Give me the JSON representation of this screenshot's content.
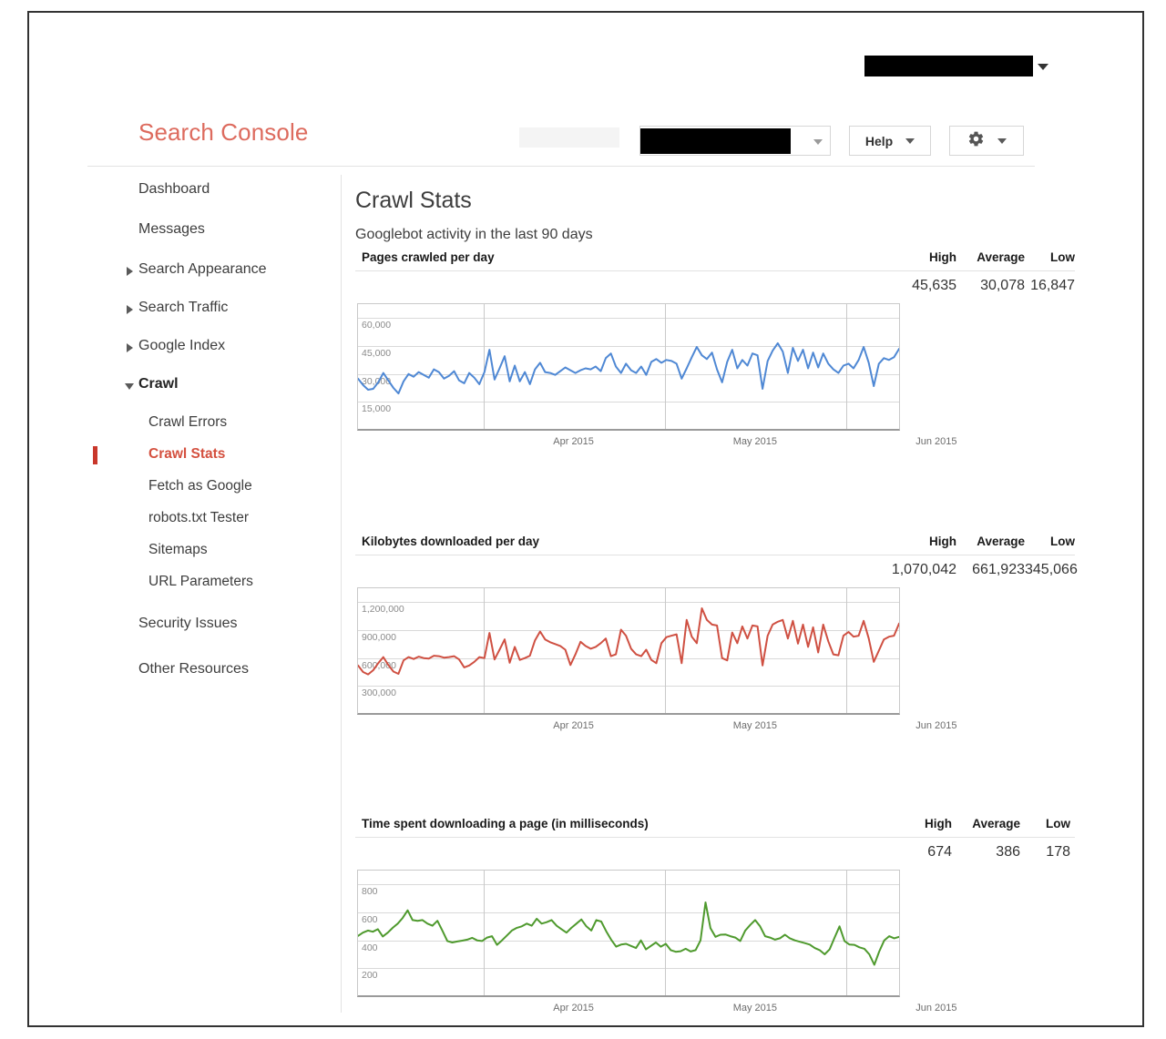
{
  "account_bar": {
    "account_chip_redacted": true,
    "caret_icon": "chevron-down-icon"
  },
  "header": {
    "brand": "Search Console",
    "property_select_redacted": true,
    "help_label": "Help",
    "gear_icon": "gear-icon",
    "caret_icon": "chevron-down-icon"
  },
  "sidebar": {
    "items": [
      {
        "label": "Dashboard",
        "type": "top"
      },
      {
        "label": "Messages",
        "type": "top"
      },
      {
        "label": "Search Appearance",
        "type": "group",
        "expanded": false
      },
      {
        "label": "Search Traffic",
        "type": "group",
        "expanded": false
      },
      {
        "label": "Google Index",
        "type": "group",
        "expanded": false
      },
      {
        "label": "Crawl",
        "type": "group",
        "expanded": true
      },
      {
        "label": "Crawl Errors",
        "type": "sub"
      },
      {
        "label": "Crawl Stats",
        "type": "sub",
        "active": true
      },
      {
        "label": "Fetch as Google",
        "type": "sub"
      },
      {
        "label": "robots.txt Tester",
        "type": "sub"
      },
      {
        "label": "Sitemaps",
        "type": "sub"
      },
      {
        "label": "URL Parameters",
        "type": "sub"
      },
      {
        "label": "Security Issues",
        "type": "plain"
      },
      {
        "label": "Other Resources",
        "type": "plain"
      }
    ]
  },
  "main": {
    "title": "Crawl Stats",
    "subtitle": "Googlebot activity in the last 90 days",
    "stat_headers": {
      "high": "High",
      "average": "Average",
      "low": "Low"
    },
    "charts": [
      {
        "title": "Pages crawled per day",
        "high": "45,635",
        "average": "30,078",
        "low": "16,847",
        "color": "#4f88d4"
      },
      {
        "title": "Kilobytes downloaded per day",
        "high": "1,070,042",
        "average": "661,923",
        "low": "345,066",
        "color": "#cf5042"
      },
      {
        "title": "Time spent downloading a page (in milliseconds)",
        "high": "674",
        "average": "386",
        "low": "178",
        "color": "#4f9a2e"
      }
    ]
  },
  "chart_data": [
    {
      "type": "line",
      "title": "Pages crawled per day",
      "xlabel": "",
      "ylabel": "",
      "ylim": [
        0,
        67500
      ],
      "yticks": [
        "60,000",
        "45,000",
        "30,000",
        "15,000"
      ],
      "ytick_values": [
        60000,
        45000,
        30000,
        15000
      ],
      "xticks": [
        "Apr 2015",
        "May 2015",
        "Jun 2015"
      ],
      "grid": true,
      "legend": "none",
      "color": "#4f88d4",
      "stats": {
        "high": 45635,
        "average": 30078,
        "low": 16847
      },
      "values": [
        27500,
        24000,
        21500,
        22000,
        25500,
        30500,
        26500,
        22500,
        19500,
        26000,
        30000,
        28500,
        31000,
        29500,
        28000,
        32500,
        31000,
        27500,
        29000,
        31500,
        26500,
        25000,
        30500,
        28000,
        24500,
        31000,
        43000,
        27000,
        33000,
        39500,
        26000,
        34500,
        26000,
        31000,
        24500,
        32500,
        36000,
        31000,
        30500,
        29500,
        31500,
        33500,
        32000,
        30500,
        32000,
        33000,
        32500,
        34000,
        31500,
        38500,
        41000,
        34000,
        30500,
        35500,
        32000,
        30500,
        34000,
        29500,
        36500,
        38000,
        36000,
        37500,
        37000,
        35500,
        27500,
        33000,
        39000,
        44500,
        40000,
        38000,
        41500,
        32500,
        25500,
        36500,
        43000,
        33000,
        37500,
        34500,
        41000,
        40000,
        22000,
        37000,
        42500,
        46500,
        42000,
        30500,
        44000,
        37000,
        43000,
        33000,
        41500,
        33500,
        41000,
        35500,
        32500,
        30500,
        34500,
        35500,
        33000,
        37500,
        44500,
        36000,
        23500,
        35500,
        38500,
        37500,
        39000,
        43500
      ]
    },
    {
      "type": "line",
      "title": "Kilobytes downloaded per day",
      "xlabel": "",
      "ylabel": "",
      "ylim": [
        0,
        1350000
      ],
      "yticks": [
        "1,200,000",
        "900,000",
        "600,000",
        "300,000"
      ],
      "ytick_values": [
        1200000,
        900000,
        600000,
        300000
      ],
      "xticks": [
        "Apr 2015",
        "May 2015",
        "Jun 2015"
      ],
      "grid": true,
      "legend": "none",
      "color": "#cf5042",
      "stats": {
        "high": 1070042,
        "average": 661923,
        "low": 345066
      },
      "values": [
        520000,
        450000,
        425000,
        470000,
        545000,
        610000,
        525000,
        455000,
        430000,
        575000,
        610000,
        590000,
        615000,
        600000,
        595000,
        625000,
        620000,
        605000,
        610000,
        620000,
        585000,
        500000,
        520000,
        560000,
        610000,
        600000,
        870000,
        585000,
        690000,
        800000,
        550000,
        720000,
        580000,
        600000,
        625000,
        790000,
        885000,
        800000,
        770000,
        750000,
        730000,
        690000,
        525000,
        640000,
        775000,
        730000,
        700000,
        720000,
        760000,
        810000,
        620000,
        640000,
        905000,
        840000,
        700000,
        640000,
        620000,
        690000,
        580000,
        545000,
        760000,
        825000,
        840000,
        855000,
        545000,
        1010000,
        830000,
        760000,
        1135000,
        1010000,
        960000,
        950000,
        600000,
        575000,
        875000,
        760000,
        940000,
        810000,
        950000,
        940000,
        520000,
        840000,
        960000,
        990000,
        1010000,
        810000,
        1000000,
        755000,
        960000,
        720000,
        930000,
        660000,
        960000,
        780000,
        640000,
        630000,
        840000,
        880000,
        830000,
        840000,
        1000000,
        810000,
        560000,
        680000,
        800000,
        830000,
        840000,
        970000
      ]
    },
    {
      "type": "line",
      "title": "Time spent downloading a page (in milliseconds)",
      "xlabel": "",
      "ylabel": "",
      "ylim": [
        0,
        900
      ],
      "yticks": [
        "800",
        "600",
        "400",
        "200"
      ],
      "ytick_values": [
        800,
        600,
        400,
        200
      ],
      "xticks": [
        "Apr 2015",
        "May 2015",
        "Jun 2015"
      ],
      "grid": true,
      "legend": "none",
      "color": "#4f9a2e",
      "stats": {
        "high": 674,
        "average": 386,
        "low": 178
      },
      "values": [
        432,
        455,
        470,
        462,
        480,
        428,
        455,
        490,
        520,
        560,
        615,
        545,
        540,
        545,
        520,
        505,
        540,
        470,
        395,
        385,
        392,
        398,
        405,
        418,
        400,
        395,
        420,
        430,
        368,
        400,
        435,
        470,
        490,
        500,
        520,
        505,
        555,
        520,
        530,
        545,
        505,
        480,
        455,
        490,
        520,
        550,
        500,
        470,
        545,
        535,
        465,
        405,
        355,
        370,
        375,
        360,
        345,
        400,
        335,
        360,
        385,
        355,
        375,
        330,
        318,
        322,
        340,
        320,
        330,
        400,
        672,
        488,
        425,
        440,
        442,
        430,
        420,
        395,
        470,
        510,
        545,
        500,
        430,
        420,
        405,
        415,
        440,
        415,
        400,
        390,
        380,
        370,
        345,
        330,
        300,
        335,
        420,
        500,
        395,
        370,
        368,
        350,
        340,
        300,
        225,
        320,
        400,
        430,
        415,
        425
      ]
    }
  ]
}
